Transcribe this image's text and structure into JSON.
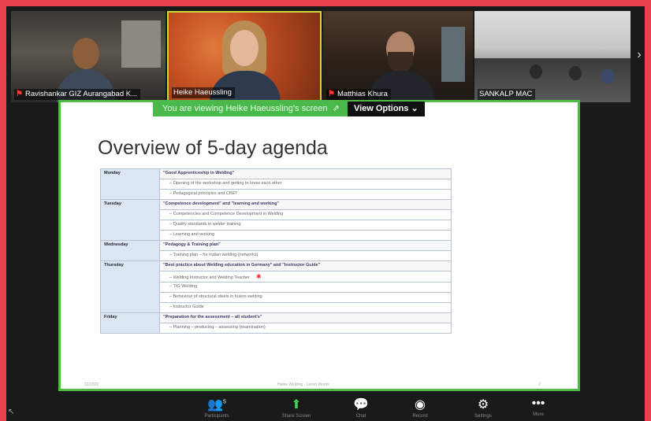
{
  "participants": [
    {
      "name": "Ravishankar GIZ Aurangabad K...",
      "muted": true
    },
    {
      "name": "Heike Haeussling",
      "muted": false
    },
    {
      "name": "Matthias Khura",
      "muted": true
    },
    {
      "name": "SANKALP MAC",
      "muted": false
    }
  ],
  "share": {
    "banner": "You are viewing Heike Haeussling's screen",
    "view_options": "View Options ⌄"
  },
  "slide": {
    "title": "Overview of 5-day agenda",
    "days": [
      {
        "day": "Monday",
        "topic": "\"Good Apprenticeship in Welding\"",
        "items": [
          "Opening of the workshop and getting to know each other",
          "Pedagogical principles and CBET"
        ]
      },
      {
        "day": "Tuesday",
        "topic": "\"Competence development\" and \"learning and working\"",
        "items": [
          "Competencies and Competence Development in Welding",
          "Quality standards in welder training",
          "Learning and working"
        ]
      },
      {
        "day": "Wednesday",
        "topic": "\"Pedagogy & Training plan\"",
        "items": [
          "Training plan – for Indian welding (networks)"
        ]
      },
      {
        "day": "Thursday",
        "topic": "\"Best practice about Welding education in Germany\" and \"Instructor Guide\"",
        "items": [
          "Welding Instructor and Welding Teacher",
          "TIG Welding",
          "Behaviour of structural steels in fusion welding",
          "Instructor Guide"
        ]
      },
      {
        "day": "Friday",
        "topic": "\"Preparation for the assessment – all student's\"",
        "items": [
          "Planning – producing – assessing (examination)"
        ]
      }
    ],
    "footer_left": "02/2020",
    "footer_center": "Heike Welding · Lasso Words",
    "footer_right": "2"
  },
  "toolbar": {
    "participants_count": "5",
    "items": [
      {
        "label": "Participants",
        "icon": "participants-icon"
      },
      {
        "label": "Share Screen",
        "icon": "share-screen-icon"
      },
      {
        "label": "Chat",
        "icon": "chat-icon"
      },
      {
        "label": "Record",
        "icon": "record-icon"
      },
      {
        "label": "Settings",
        "icon": "gear-icon"
      },
      {
        "label": "More",
        "icon": "more-icon"
      }
    ]
  }
}
